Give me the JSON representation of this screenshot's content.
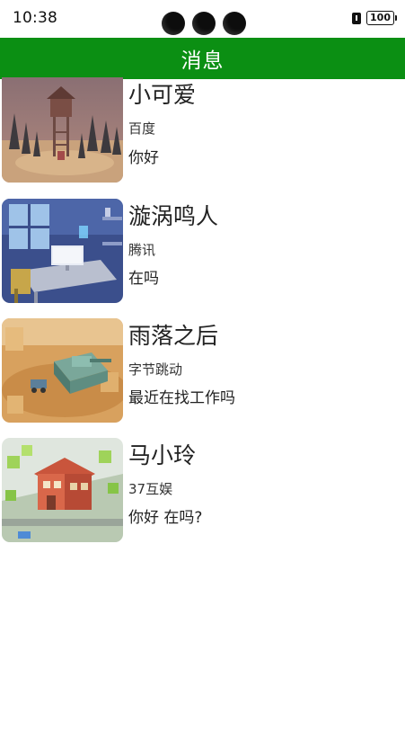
{
  "status_bar": {
    "time": "10:38",
    "battery": "100"
  },
  "header": {
    "title": "消息"
  },
  "messages": [
    {
      "name": "小可爱",
      "company": "百度",
      "text": "你好"
    },
    {
      "name": "漩涡鸣人",
      "company": "腾讯",
      "text": "在吗"
    },
    {
      "name": "雨落之后",
      "company": "字节跳动",
      "text": "最近在找工作吗"
    },
    {
      "name": "马小玲",
      "company": "37互娱",
      "text": "你好 在吗?"
    }
  ],
  "colors": {
    "header_bg": "#0b8f13",
    "header_text": "#ffffff",
    "page_bg": "#ffffff"
  }
}
